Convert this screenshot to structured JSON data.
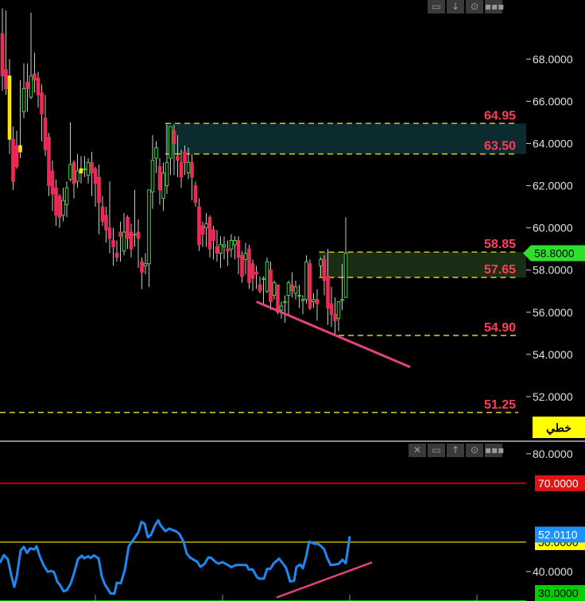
{
  "chart_data": [
    {
      "type": "candlestick",
      "ylim": [
        50.0,
        70.8
      ],
      "grid": false,
      "axis_ticks": [
        "68.0000",
        "66.0000",
        "64.0000",
        "62.0000",
        "60.0000",
        "58.0000",
        "56.0000",
        "54.0000",
        "52.0000"
      ],
      "tick_values": [
        68,
        66,
        64,
        62,
        60,
        58,
        56,
        54,
        52
      ],
      "last_price": {
        "label": "58.8000",
        "value": 58.8
      },
      "badge": {
        "label": "خطي"
      },
      "levels": [
        {
          "label": "64.95",
          "value": 64.95
        },
        {
          "label": "63.50",
          "value": 63.5
        },
        {
          "label": "58.85",
          "value": 58.85
        },
        {
          "label": "57.65",
          "value": 57.65
        },
        {
          "label": "54.90",
          "value": 54.9
        },
        {
          "label": "51.25",
          "value": 51.25
        }
      ],
      "zones": [
        {
          "from": 63.5,
          "to": 64.95,
          "start_index": 46,
          "fill": "#0b2b2e"
        },
        {
          "from": 57.65,
          "to": 58.85,
          "start_index": 89,
          "fill": "#1a2e16"
        }
      ],
      "trendline": [
        {
          "index": 71,
          "value": 56.5
        },
        {
          "index": 114,
          "value": 53.4
        }
      ],
      "candles": [
        [
          69.2,
          70.4,
          67.2,
          66.5
        ],
        [
          67.5,
          70.3,
          66.6,
          66.3
        ],
        [
          67.2,
          68.0,
          64.2,
          63.5
        ],
        [
          64.2,
          64.8,
          62.2,
          61.8
        ],
        [
          63.9,
          64.6,
          62.9,
          62.8
        ],
        [
          63.6,
          67.0,
          63.9,
          63.3
        ],
        [
          65.5,
          67.8,
          66.6,
          65.2
        ],
        [
          66.9,
          67.8,
          66.6,
          65.5
        ],
        [
          66.2,
          70.2,
          67.2,
          66.1
        ],
        [
          67.3,
          68.3,
          67.0,
          66.4
        ],
        [
          67.1,
          67.4,
          66.3,
          65.7
        ],
        [
          66.4,
          66.8,
          65.4,
          64.1
        ],
        [
          65.2,
          66.3,
          63.7,
          63.4
        ],
        [
          64.3,
          64.5,
          62.0,
          61.5
        ],
        [
          62.7,
          63.2,
          61.6,
          60.8
        ],
        [
          61.9,
          62.3,
          60.6,
          60.1
        ],
        [
          61.5,
          61.6,
          60.5,
          60.0
        ],
        [
          60.6,
          61.9,
          61.3,
          60.3
        ],
        [
          61.1,
          62.2,
          61.9,
          60.5
        ],
        [
          62.3,
          65.0,
          63.0,
          62.2
        ],
        [
          63.1,
          63.2,
          62.1,
          61.4
        ],
        [
          62.2,
          63.5,
          62.7,
          61.9
        ],
        [
          62.8,
          63.4,
          62.6,
          62.1
        ],
        [
          62.8,
          63.4,
          62.8,
          62.4
        ],
        [
          62.5,
          63.3,
          63.1,
          62.1
        ],
        [
          63.1,
          63.6,
          62.6,
          61.5
        ],
        [
          62.8,
          62.9,
          62.1,
          61.0
        ],
        [
          62.4,
          63.0,
          61.2,
          59.7
        ],
        [
          61.0,
          61.5,
          60.3,
          60.1
        ],
        [
          60.6,
          61.0,
          59.9,
          59.3
        ],
        [
          60.0,
          62.2,
          59.5,
          58.8
        ],
        [
          59.4,
          60.0,
          59.1,
          58.2
        ],
        [
          58.8,
          59.4,
          58.6,
          58.4
        ],
        [
          59.8,
          60.3,
          59.6,
          58.4
        ],
        [
          58.9,
          60.7,
          59.8,
          58.7
        ],
        [
          60.5,
          60.6,
          59.5,
          59.0
        ],
        [
          59.8,
          60.2,
          59.0,
          58.6
        ],
        [
          59.7,
          61.8,
          59.7,
          59.1
        ],
        [
          59.8,
          60.4,
          59.5,
          58.1
        ],
        [
          58.4,
          58.6,
          57.9,
          57.1
        ],
        [
          58.2,
          58.8,
          58.3,
          57.8
        ],
        [
          58.3,
          60.1,
          61.8,
          57.2
        ],
        [
          61.7,
          64.4,
          63.2,
          60.9
        ],
        [
          63.3,
          64.1,
          63.8,
          62.6
        ],
        [
          62.9,
          63.3,
          61.8,
          61.1
        ],
        [
          61.4,
          63.1,
          62.6,
          60.8
        ],
        [
          62.0,
          64.9,
          63.1,
          61.6
        ],
        [
          63.3,
          64.8,
          64.8,
          62.5
        ],
        [
          64.6,
          64.9,
          64.0,
          62.5
        ],
        [
          63.4,
          64.4,
          63.2,
          62.4
        ],
        [
          63.1,
          63.7,
          62.4,
          61.9
        ],
        [
          63.6,
          63.9,
          63.1,
          62.5
        ],
        [
          62.6,
          63.8,
          63.1,
          62.3
        ],
        [
          63.1,
          63.5,
          62.4,
          61.3
        ],
        [
          62.0,
          62.2,
          61.2,
          61.0
        ],
        [
          61.0,
          61.4,
          59.2,
          58.9
        ],
        [
          60.1,
          60.3,
          59.7,
          59.1
        ],
        [
          60.0,
          60.7,
          60.2,
          59.1
        ],
        [
          60.5,
          60.6,
          59.0,
          58.6
        ],
        [
          59.9,
          60.1,
          59.4,
          58.5
        ],
        [
          59.1,
          59.9,
          58.8,
          58.4
        ],
        [
          58.8,
          59.6,
          59.2,
          58.1
        ],
        [
          59.1,
          59.6,
          59.2,
          58.5
        ],
        [
          59.0,
          59.4,
          58.9,
          58.2
        ],
        [
          59.0,
          59.7,
          59.4,
          58.6
        ],
        [
          59.2,
          59.6,
          59.4,
          58.5
        ],
        [
          59.4,
          59.6,
          58.6,
          57.8
        ],
        [
          58.7,
          58.9,
          57.7,
          57.4
        ],
        [
          58.5,
          59.3,
          58.8,
          57.8
        ],
        [
          59.0,
          59.2,
          57.4,
          57.1
        ],
        [
          58.3,
          58.5,
          57.6,
          57.0
        ],
        [
          57.9,
          58.2,
          57.8,
          57.1
        ],
        [
          57.3,
          57.7,
          57.0,
          56.9
        ],
        [
          57.6,
          57.7,
          57.6,
          56.3
        ],
        [
          57.0,
          58.6,
          58.4,
          56.9
        ],
        [
          58.0,
          58.4,
          56.5,
          56.1
        ],
        [
          56.8,
          57.5,
          57.4,
          56.6
        ],
        [
          57.3,
          57.3,
          56.0,
          55.9
        ],
        [
          56.1,
          56.5,
          56.3,
          55.7
        ],
        [
          56.5,
          56.8,
          56.5,
          55.5
        ],
        [
          56.8,
          57.5,
          57.4,
          55.9
        ],
        [
          57.3,
          57.9,
          57.0,
          56.7
        ],
        [
          56.9,
          57.5,
          57.2,
          56.6
        ],
        [
          56.8,
          57.3,
          56.8,
          56.2
        ],
        [
          56.6,
          56.8,
          56.6,
          55.9
        ],
        [
          56.6,
          58.7,
          58.4,
          56.4
        ],
        [
          58.3,
          58.5,
          56.2,
          56.1
        ],
        [
          56.5,
          56.9,
          56.6,
          56.2
        ],
        [
          56.6,
          57.1,
          56.4,
          55.6
        ],
        [
          58.2,
          58.6,
          58.5,
          57.7
        ],
        [
          58.5,
          58.7,
          57.5,
          56.8
        ],
        [
          57.7,
          59.0,
          56.2,
          55.4
        ],
        [
          56.4,
          57.2,
          55.9,
          55.3
        ],
        [
          55.9,
          56.7,
          55.6,
          54.9
        ],
        [
          55.7,
          56.5,
          56.5,
          55.1
        ],
        [
          56.6,
          58.3,
          56.6,
          56.1
        ],
        [
          56.7,
          60.5,
          58.8,
          56.7
        ]
      ]
    },
    {
      "type": "line",
      "ylim": [
        30.0,
        84.0
      ],
      "grid": false,
      "axis_ticks": [
        "80.0000",
        "40.0000"
      ],
      "tick_values": [
        80,
        40
      ],
      "levels": [
        {
          "label": "70.0000",
          "value": 70,
          "color": "#c00000",
          "badge_bg": "#e01414",
          "badge_fg": "#ffffff"
        },
        {
          "label": "50.0000",
          "value": 50,
          "color": "#8e8e00",
          "badge_bg": "#ffff00",
          "badge_fg": "#000000"
        },
        {
          "label": "30.0000",
          "value": 30,
          "color": "#00b300",
          "badge_bg": "#00d000",
          "badge_fg": "#000000"
        }
      ],
      "last_value": {
        "label": "52.0110",
        "value": 52.011
      },
      "series": [
        {
          "x": [
            0,
            5,
            10,
            14,
            18,
            21,
            26,
            30,
            34,
            38,
            43,
            46,
            50,
            55,
            60,
            64,
            68,
            72,
            76,
            80,
            84,
            89,
            94,
            98,
            103,
            106,
            111,
            114,
            118,
            124,
            128,
            132,
            139,
            144,
            147,
            152,
            157,
            162,
            169,
            174,
            178,
            182,
            186,
            190,
            195,
            199,
            202,
            208,
            213,
            217,
            222,
            226,
            231,
            235,
            239,
            243,
            248,
            252,
            257,
            262,
            266,
            271,
            275,
            280,
            286,
            291,
            297,
            303,
            310,
            313,
            318,
            323,
            326,
            332,
            336,
            340,
            345,
            348,
            351,
            356,
            360,
            365,
            370,
            373,
            378,
            381,
            385,
            389,
            392,
            396,
            400,
            404,
            408,
            412,
            416,
            421,
            426,
            431,
            435,
            440
          ],
          "y": [
            43.0,
            45.6,
            44.1,
            38.9,
            34.8,
            38.2,
            47.2,
            48.4,
            46.3,
            47.9,
            47.5,
            48.6,
            45.2,
            42.1,
            39.9,
            40.2,
            39.8,
            36.6,
            35.2,
            33.3,
            33.7,
            35.9,
            40.2,
            44.2,
            45.4,
            44.5,
            45.2,
            44.6,
            45.5,
            44.5,
            38.4,
            35.6,
            32.6,
            32.5,
            36.2,
            36.0,
            40.5,
            48.6,
            51.3,
            53.3,
            56.9,
            56.2,
            51.6,
            52.5,
            55.7,
            57.4,
            55.7,
            53.7,
            54.6,
            54.1,
            53.6,
            52.7,
            50.0,
            46.1,
            44.8,
            44.1,
            43.4,
            41.6,
            42.5,
            44.8,
            44.6,
            43.3,
            42.7,
            43.2,
            42.3,
            41.5,
            42.2,
            42.2,
            42.2,
            40.7,
            40.7,
            38.2,
            37.6,
            37.6,
            40.9,
            40.9,
            43.0,
            43.6,
            44.4,
            42.7,
            41.2,
            36.6,
            36.9,
            41.6,
            42.4,
            41.1,
            44.9,
            50.2,
            49.8,
            49.4,
            49.4,
            48.6,
            47.5,
            44.4,
            42.2,
            42.4,
            42.6,
            44.0,
            42.8,
            52.0
          ]
        }
      ],
      "trendline": [
        {
          "x": 348,
          "value": 31.2
        },
        {
          "x": 468,
          "value": 43.1
        }
      ]
    }
  ],
  "toolbars": {
    "main": [
      "▭",
      "↓",
      "⊙",
      "▪▪▪"
    ],
    "lower": [
      "✕",
      "▭",
      "↑",
      "⊙",
      "▪▪▪"
    ]
  },
  "colors": {
    "background": "#000000",
    "bull_candle": "#34dd34",
    "bear_candle": "#ec2a55",
    "highlight_candle": "#ffe600",
    "level_line": "#c9c02a",
    "level_label": "#ff3d5a",
    "trendline": "#e5427c",
    "indicator_line": "#1e88f0",
    "last_price_badge": "#2fe02f",
    "badge_bg": "#ffff00",
    "last_value_badge": "#1e90ff"
  }
}
